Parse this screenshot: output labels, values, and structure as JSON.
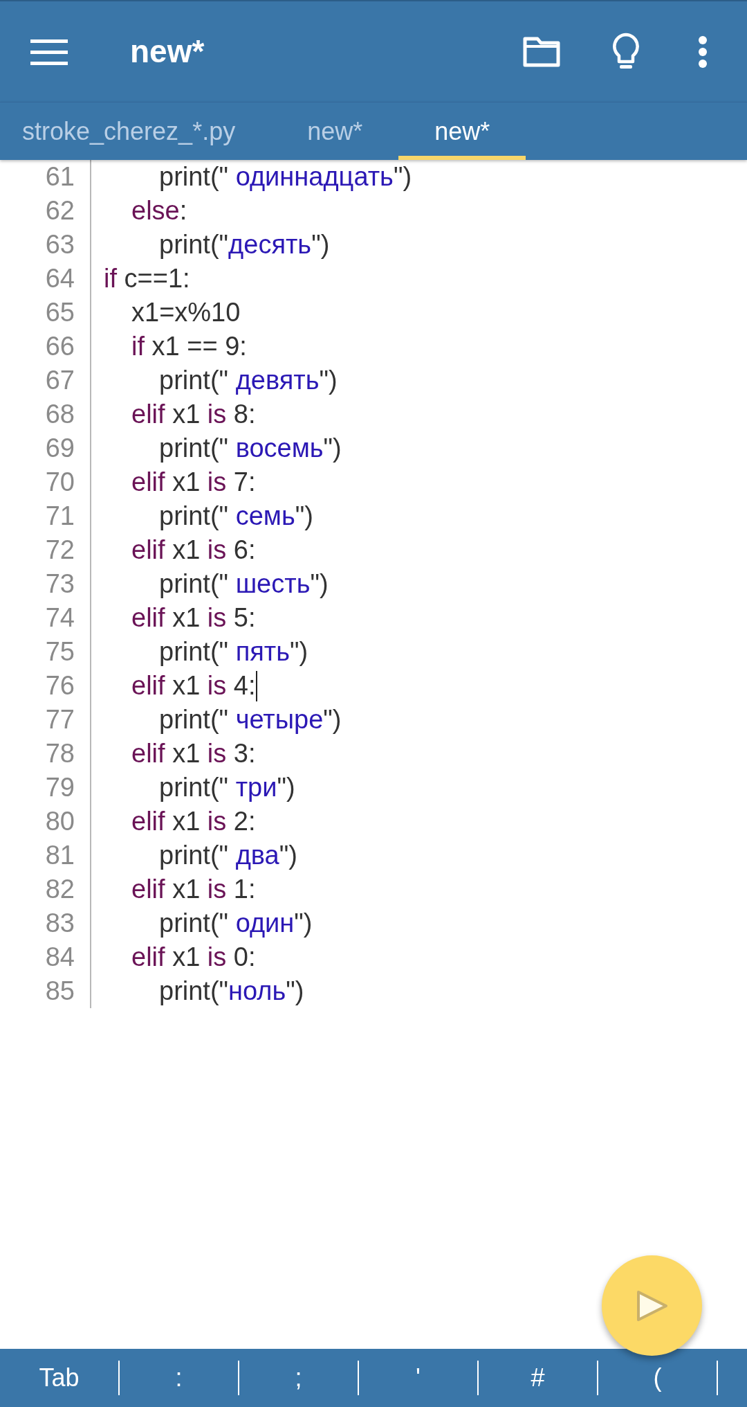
{
  "app_bar": {
    "title": "new*"
  },
  "tabs": [
    {
      "label": "stroke_cherez_*.py",
      "selected": false
    },
    {
      "label": "new*",
      "selected": false
    },
    {
      "label": "new*",
      "selected": true
    }
  ],
  "lines": [
    {
      "number": "61",
      "cursor": false,
      "tokens": [
        {
          "kind": "plain",
          "text": "        print(\""
        },
        {
          "kind": "string",
          "text": " одиннадцать"
        },
        {
          "kind": "plain",
          "text": "\")"
        }
      ]
    },
    {
      "number": "62",
      "cursor": false,
      "tokens": [
        {
          "kind": "keyword",
          "text": "    else"
        },
        {
          "kind": "plain",
          "text": ":"
        }
      ]
    },
    {
      "number": "63",
      "cursor": false,
      "tokens": [
        {
          "kind": "plain",
          "text": "        print(\""
        },
        {
          "kind": "string",
          "text": "десять"
        },
        {
          "kind": "plain",
          "text": "\")"
        }
      ]
    },
    {
      "number": "64",
      "cursor": false,
      "tokens": [
        {
          "kind": "keyword",
          "text": "if"
        },
        {
          "kind": "plain",
          "text": " c==1:"
        }
      ]
    },
    {
      "number": "65",
      "cursor": false,
      "tokens": [
        {
          "kind": "plain",
          "text": "    x1=x%10"
        }
      ]
    },
    {
      "number": "66",
      "cursor": false,
      "tokens": [
        {
          "kind": "keyword",
          "text": "    if"
        },
        {
          "kind": "plain",
          "text": " x1 == 9:"
        }
      ]
    },
    {
      "number": "67",
      "cursor": false,
      "tokens": [
        {
          "kind": "plain",
          "text": "        print(\""
        },
        {
          "kind": "string",
          "text": " девять"
        },
        {
          "kind": "plain",
          "text": "\")"
        }
      ]
    },
    {
      "number": "68",
      "cursor": false,
      "tokens": [
        {
          "kind": "keyword",
          "text": "    elif"
        },
        {
          "kind": "plain",
          "text": " x1 "
        },
        {
          "kind": "keyword",
          "text": "is"
        },
        {
          "kind": "plain",
          "text": " 8:"
        }
      ]
    },
    {
      "number": "69",
      "cursor": false,
      "tokens": [
        {
          "kind": "plain",
          "text": "        print(\""
        },
        {
          "kind": "string",
          "text": " восемь"
        },
        {
          "kind": "plain",
          "text": "\")"
        }
      ]
    },
    {
      "number": "70",
      "cursor": false,
      "tokens": [
        {
          "kind": "keyword",
          "text": "    elif"
        },
        {
          "kind": "plain",
          "text": " x1 "
        },
        {
          "kind": "keyword",
          "text": "is"
        },
        {
          "kind": "plain",
          "text": " 7:"
        }
      ]
    },
    {
      "number": "71",
      "cursor": false,
      "tokens": [
        {
          "kind": "plain",
          "text": "        print(\""
        },
        {
          "kind": "string",
          "text": " семь"
        },
        {
          "kind": "plain",
          "text": "\")"
        }
      ]
    },
    {
      "number": "72",
      "cursor": false,
      "tokens": [
        {
          "kind": "keyword",
          "text": "    elif"
        },
        {
          "kind": "plain",
          "text": " x1 "
        },
        {
          "kind": "keyword",
          "text": "is"
        },
        {
          "kind": "plain",
          "text": " 6:"
        }
      ]
    },
    {
      "number": "73",
      "cursor": false,
      "tokens": [
        {
          "kind": "plain",
          "text": "        print(\""
        },
        {
          "kind": "string",
          "text": " шесть"
        },
        {
          "kind": "plain",
          "text": "\")"
        }
      ]
    },
    {
      "number": "74",
      "cursor": false,
      "tokens": [
        {
          "kind": "keyword",
          "text": "    elif"
        },
        {
          "kind": "plain",
          "text": " x1 "
        },
        {
          "kind": "keyword",
          "text": "is"
        },
        {
          "kind": "plain",
          "text": " 5:"
        }
      ]
    },
    {
      "number": "75",
      "cursor": false,
      "tokens": [
        {
          "kind": "plain",
          "text": "        print(\""
        },
        {
          "kind": "string",
          "text": " пять"
        },
        {
          "kind": "plain",
          "text": "\")"
        }
      ]
    },
    {
      "number": "76",
      "cursor": true,
      "tokens": [
        {
          "kind": "keyword",
          "text": "    elif"
        },
        {
          "kind": "plain",
          "text": " x1 "
        },
        {
          "kind": "keyword",
          "text": "is"
        },
        {
          "kind": "plain",
          "text": " 4:"
        }
      ]
    },
    {
      "number": "77",
      "cursor": false,
      "tokens": [
        {
          "kind": "plain",
          "text": "        print(\""
        },
        {
          "kind": "string",
          "text": " четыре"
        },
        {
          "kind": "plain",
          "text": "\")"
        }
      ]
    },
    {
      "number": "78",
      "cursor": false,
      "tokens": [
        {
          "kind": "keyword",
          "text": "    elif"
        },
        {
          "kind": "plain",
          "text": " x1 "
        },
        {
          "kind": "keyword",
          "text": "is"
        },
        {
          "kind": "plain",
          "text": " 3:"
        }
      ]
    },
    {
      "number": "79",
      "cursor": false,
      "tokens": [
        {
          "kind": "plain",
          "text": "        print(\""
        },
        {
          "kind": "string",
          "text": " три"
        },
        {
          "kind": "plain",
          "text": "\")"
        }
      ]
    },
    {
      "number": "80",
      "cursor": false,
      "tokens": [
        {
          "kind": "keyword",
          "text": "    elif"
        },
        {
          "kind": "plain",
          "text": " x1 "
        },
        {
          "kind": "keyword",
          "text": "is"
        },
        {
          "kind": "plain",
          "text": " 2:"
        }
      ]
    },
    {
      "number": "81",
      "cursor": false,
      "tokens": [
        {
          "kind": "plain",
          "text": "        print(\""
        },
        {
          "kind": "string",
          "text": " два"
        },
        {
          "kind": "plain",
          "text": "\")"
        }
      ]
    },
    {
      "number": "82",
      "cursor": false,
      "tokens": [
        {
          "kind": "keyword",
          "text": "    elif"
        },
        {
          "kind": "plain",
          "text": " x1 "
        },
        {
          "kind": "keyword",
          "text": "is"
        },
        {
          "kind": "plain",
          "text": " 1:"
        }
      ]
    },
    {
      "number": "83",
      "cursor": false,
      "tokens": [
        {
          "kind": "plain",
          "text": "        print(\""
        },
        {
          "kind": "string",
          "text": " один"
        },
        {
          "kind": "plain",
          "text": "\")"
        }
      ]
    },
    {
      "number": "84",
      "cursor": false,
      "tokens": [
        {
          "kind": "keyword",
          "text": "    elif"
        },
        {
          "kind": "plain",
          "text": " x1 "
        },
        {
          "kind": "keyword",
          "text": "is"
        },
        {
          "kind": "plain",
          "text": " 0:"
        }
      ]
    },
    {
      "number": "85",
      "cursor": false,
      "tokens": [
        {
          "kind": "plain",
          "text": "        print(\""
        },
        {
          "kind": "string",
          "text": "ноль"
        },
        {
          "kind": "plain",
          "text": "\")"
        }
      ]
    }
  ],
  "keys": [
    "Tab",
    ":",
    ";",
    "'",
    "#",
    "("
  ]
}
